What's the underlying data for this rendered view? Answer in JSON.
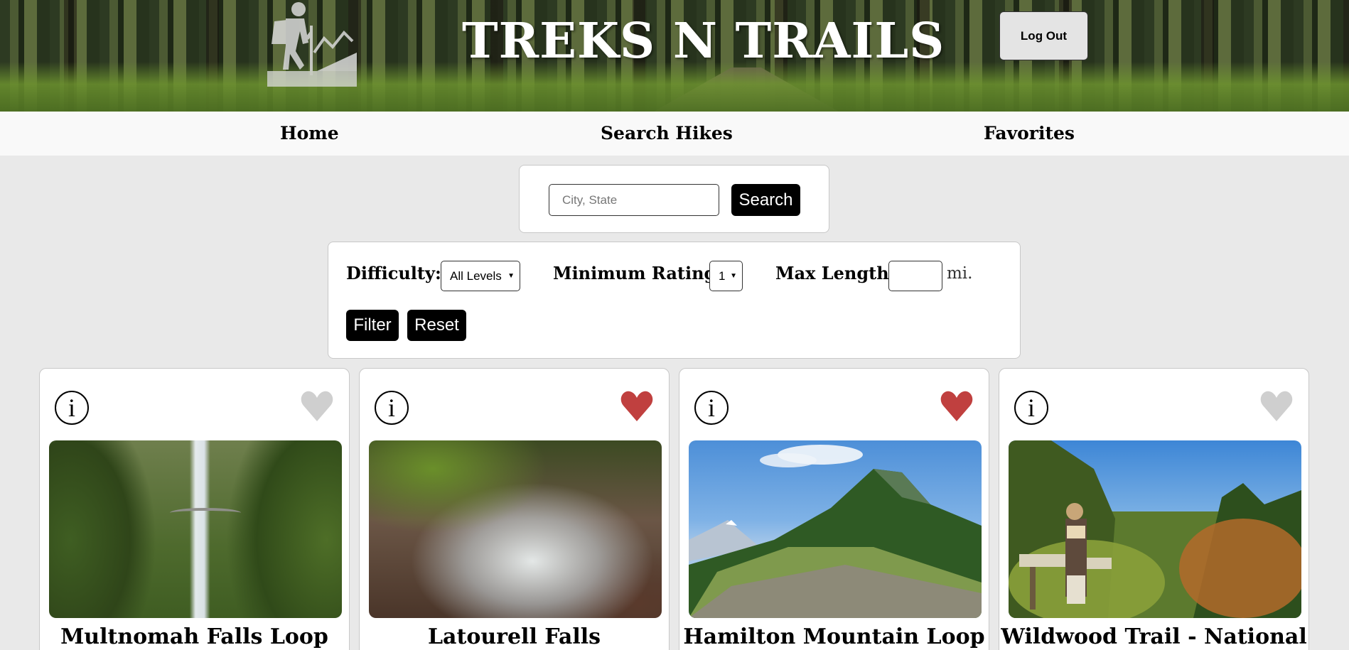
{
  "header": {
    "title": "TREKS N TRAILS",
    "logout_label": "Log Out"
  },
  "nav": {
    "items": [
      {
        "label": "Home"
      },
      {
        "label": "Search Hikes"
      },
      {
        "label": "Favorites"
      }
    ]
  },
  "search": {
    "placeholder": "City, State",
    "value": "",
    "button_label": "Search"
  },
  "filters": {
    "difficulty_label": "Difficulty:",
    "difficulty_value": "All Levels",
    "rating_label": "Minimum Rating:",
    "rating_value": "1",
    "max_length_label": "Max Length:",
    "max_length_value": "",
    "unit": "mi.",
    "filter_label": "Filter",
    "reset_label": "Reset"
  },
  "cards": [
    {
      "title": "Multnomah Falls Loop",
      "favorited": false,
      "info_icon": "i"
    },
    {
      "title": "Latourell Falls",
      "favorited": true,
      "info_icon": "i"
    },
    {
      "title": "Hamilton Mountain Loop",
      "favorited": true,
      "info_icon": "i"
    },
    {
      "title": "Wildwood Trail - National",
      "favorited": false,
      "info_icon": "i"
    }
  ],
  "colors": {
    "heart_active": "#c0403f",
    "heart_inactive": "#cfcfcf",
    "button_dark": "#000000",
    "page_bg": "#e9e9e9"
  }
}
